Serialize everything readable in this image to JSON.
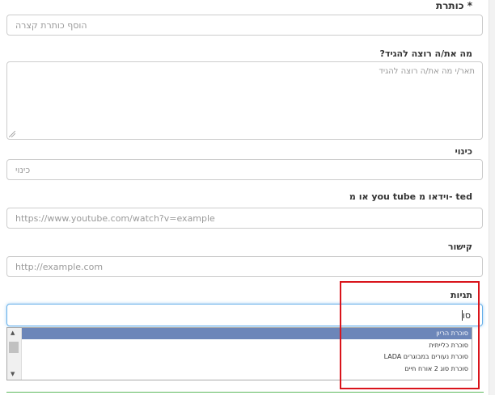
{
  "form": {
    "title": {
      "label": "* כותרת",
      "placeholder": "הוסף כותרת קצרה"
    },
    "message": {
      "label": "מה את/ה רוצה להגיד?",
      "placeholder": "תאר/י מה את/ה רוצה להגיד"
    },
    "nickname": {
      "label": "כינוי",
      "placeholder": "כינוי"
    },
    "video": {
      "label": "ted -וידאו מ you tube או מ",
      "placeholder": "https://www.youtube.com/watch?v=example"
    },
    "link": {
      "label": "קישור",
      "placeholder": "http://example.com"
    },
    "tags": {
      "label": "תגיות",
      "value": "סו",
      "suggestions": [
        "סוכרת הריון",
        "סוכרת כלייתית",
        "סוכרת נעורים במבוגרים LADA",
        "סוכרת סוג 2 אורח חיים"
      ]
    }
  },
  "colors": {
    "selected_option": "#6c86b9",
    "focus_border": "#66afe9",
    "highlight_box": "#d9141b"
  }
}
